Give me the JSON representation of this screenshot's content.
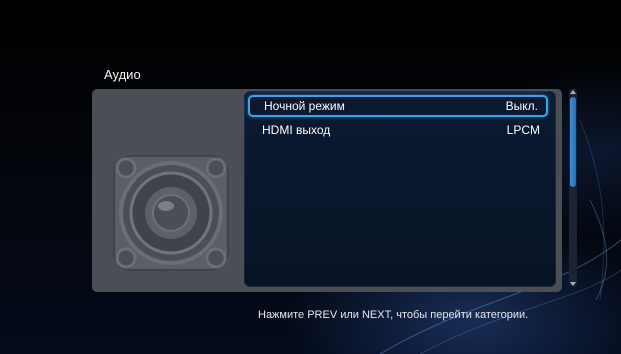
{
  "section": {
    "title": "Аудио",
    "icon": "speaker-icon"
  },
  "settings": {
    "items": [
      {
        "label": "Ночной режим",
        "value": "Выкл.",
        "selected": true
      },
      {
        "label": "HDMI выход",
        "value": "LPCM",
        "selected": false
      }
    ]
  },
  "hint": {
    "text": "Нажмите PREV или NEXT, чтобы перейти категории."
  },
  "colors": {
    "accent": "#3fa4e6",
    "panel": "#4b4f55",
    "list_background": "#0b1a33"
  }
}
